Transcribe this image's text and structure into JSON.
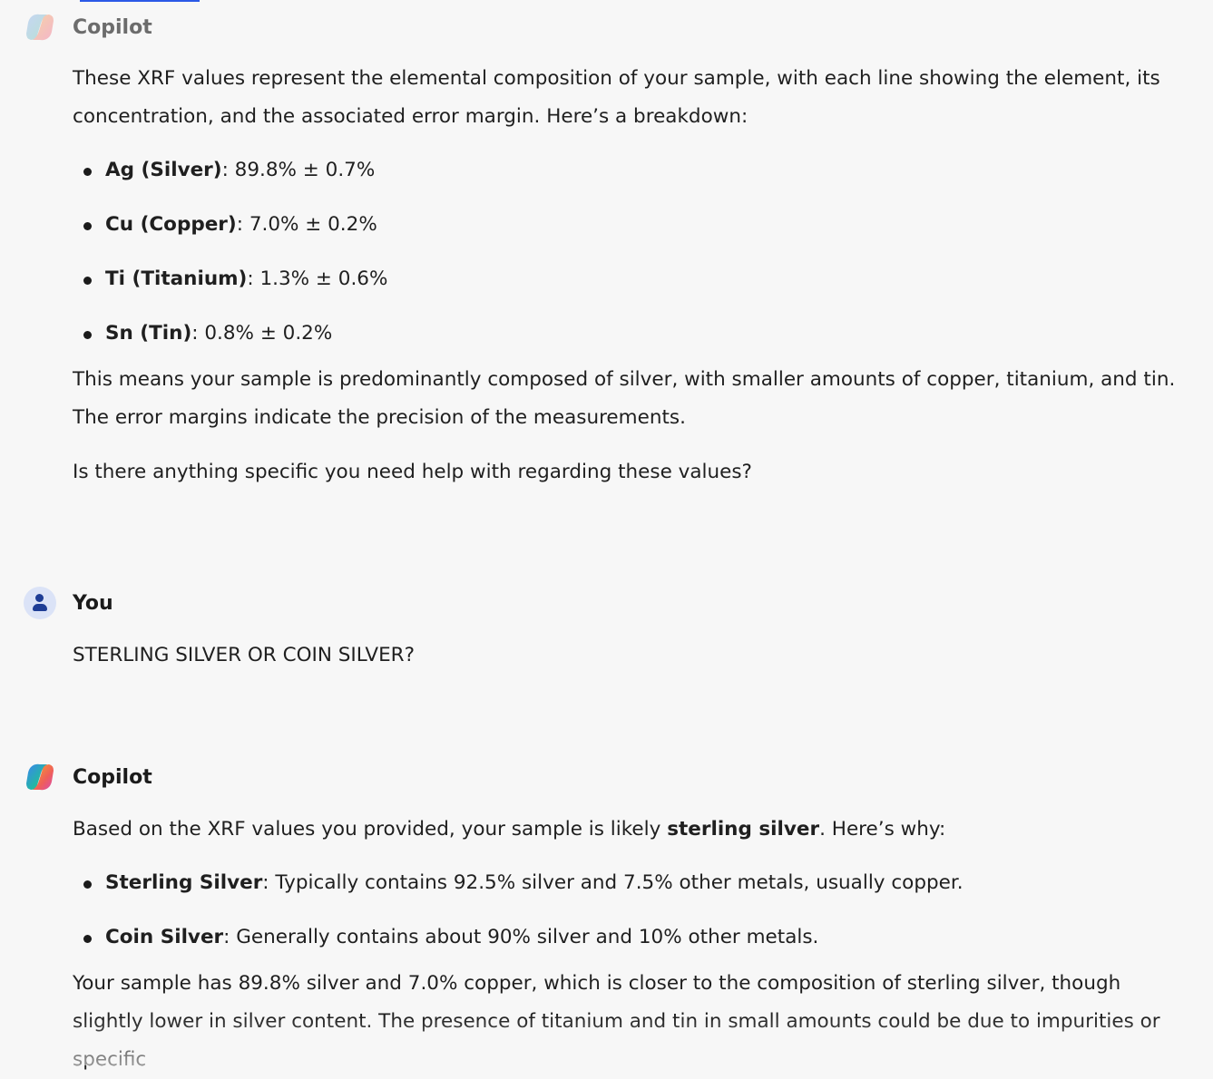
{
  "messages": [
    {
      "sender": "Copilot",
      "intro": "These XRF values represent the elemental composition of your sample, with each line showing the element, its concentration, and the associated error margin. Here’s a breakdown:",
      "elements": [
        {
          "term": "Ag (Silver)",
          "value": ": 89.8% ± 0.7%"
        },
        {
          "term": "Cu (Copper)",
          "value": ": 7.0% ± 0.2%"
        },
        {
          "term": "Ti (Titanium)",
          "value": ": 1.3% ± 0.6%"
        },
        {
          "term": "Sn (Tin)",
          "value": ": 0.8% ± 0.2%"
        }
      ],
      "summary": "This means your sample is predominantly composed of silver, with smaller amounts of copper, titanium, and tin. The error margins indicate the precision of the measurements.",
      "question": "Is there anything specific you need help with regarding these values?"
    },
    {
      "sender": "You",
      "text": "STERLING SILVER OR COIN SILVER?"
    },
    {
      "sender": "Copilot",
      "intro_prefix": "Based on the XRF values you provided, your sample is likely ",
      "intro_bold": "sterling silver",
      "intro_suffix": ". Here’s why:",
      "types": [
        {
          "term": "Sterling Silver",
          "value": ": Typically contains 92.5% silver and 7.5% other metals, usually copper."
        },
        {
          "term": "Coin Silver",
          "value": ": Generally contains about 90% silver and 10% other metals."
        }
      ],
      "conclusion": "Your sample has 89.8% silver and 7.0% copper, which is closer to the composition of sterling silver, though slightly lower in silver content. The presence of titanium and tin in small amounts could be due to impurities or specific"
    }
  ],
  "colors": {
    "background": "#f7f7f7",
    "text": "#1f1f1f",
    "link_accent": "#2b59e6",
    "user_avatar_bg": "#dbe3f7",
    "user_avatar_fg": "#1e3d95"
  },
  "icons": {
    "copilot": "copilot-logo-icon",
    "user": "user-avatar-icon"
  }
}
